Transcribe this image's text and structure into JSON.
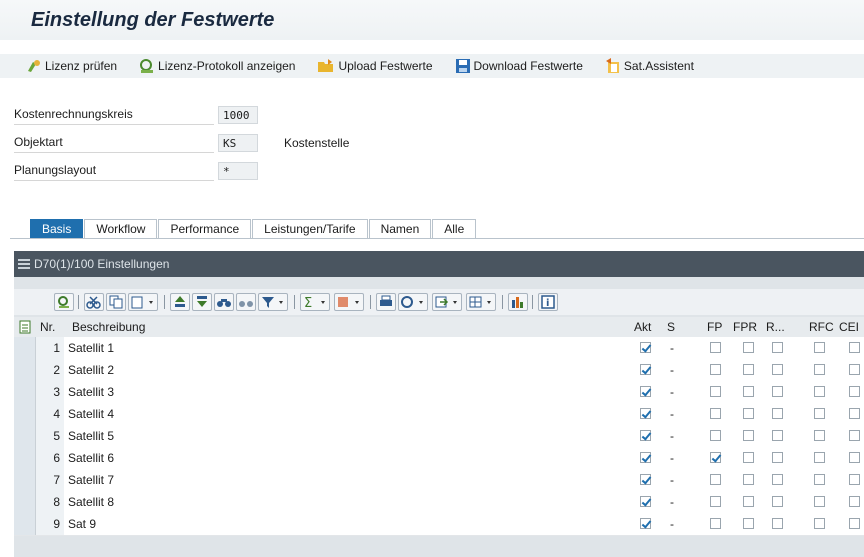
{
  "page": {
    "title": "Einstellung der Festwerte"
  },
  "toolbar": {
    "buttons": [
      {
        "label": "Lizenz prüfen",
        "icon": "license-check-icon"
      },
      {
        "label": "Lizenz-Protokoll anzeigen",
        "icon": "protocol-search-icon"
      },
      {
        "label": "Upload Festwerte",
        "icon": "upload-folder-icon"
      },
      {
        "label": "Download Festwerte",
        "icon": "save-disk-icon"
      },
      {
        "label": "Sat.Assistent",
        "icon": "assistant-icon"
      }
    ]
  },
  "fields": [
    {
      "label": "Kostenrechnungskreis",
      "value": "1000",
      "desc": ""
    },
    {
      "label": "Objektart",
      "value": "KS",
      "desc": "Kostenstelle"
    },
    {
      "label": "Planungslayout",
      "value": "*",
      "desc": ""
    }
  ],
  "tabs": [
    "Basis",
    "Workflow",
    "Performance",
    "Leistungen/Tarife",
    "Namen",
    "Alle"
  ],
  "active_tab": "Basis",
  "panel": {
    "header": "D70(1)/100 Einstellungen"
  },
  "grid": {
    "columns": [
      "Nr.",
      "Beschreibung",
      "Akt",
      "S",
      "FP",
      "FPR",
      "R...",
      "RFC",
      "CEI"
    ],
    "rows": [
      {
        "nr": "1",
        "desc": "Satellit 1",
        "akt": true,
        "s": "-",
        "fp": false
      },
      {
        "nr": "2",
        "desc": "Satellit 2",
        "akt": true,
        "s": "-",
        "fp": false
      },
      {
        "nr": "3",
        "desc": "Satellit 3",
        "akt": true,
        "s": "-",
        "fp": false
      },
      {
        "nr": "4",
        "desc": "Satellit 4",
        "akt": true,
        "s": "-",
        "fp": false
      },
      {
        "nr": "5",
        "desc": "Satellit 5",
        "akt": true,
        "s": "-",
        "fp": false
      },
      {
        "nr": "6",
        "desc": "Satellit 6",
        "akt": true,
        "s": "-",
        "fp": true
      },
      {
        "nr": "7",
        "desc": "Satellit 7",
        "akt": true,
        "s": "-",
        "fp": false
      },
      {
        "nr": "8",
        "desc": "Satellit 8",
        "akt": true,
        "s": "-",
        "fp": false
      },
      {
        "nr": "9",
        "desc": "Sat 9",
        "akt": true,
        "s": "-",
        "fp": false
      }
    ]
  },
  "colors": {
    "accent": "#1f6fae",
    "panel_header": "#4a5560"
  }
}
